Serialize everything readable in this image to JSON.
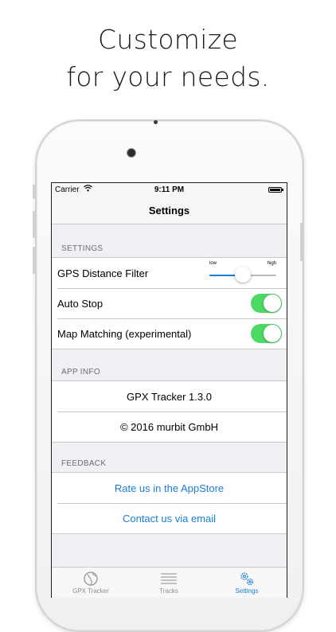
{
  "headline": {
    "line1": "Customize",
    "line2": "for your needs."
  },
  "status_bar": {
    "carrier": "Carrier",
    "time": "9:11 PM"
  },
  "navbar": {
    "title": "Settings"
  },
  "sections": {
    "settings": {
      "header": "SETTINGS",
      "gps_filter": {
        "label": "GPS Distance Filter",
        "low": "low",
        "high": "high",
        "value": 0.5
      },
      "auto_stop": {
        "label": "Auto Stop",
        "on": true
      },
      "map_matching": {
        "label": "Map Matching (experimental)",
        "on": true
      }
    },
    "app_info": {
      "header": "APP INFO",
      "version": "GPX Tracker 1.3.0",
      "copyright": "© 2016 murbit GmbH"
    },
    "feedback": {
      "header": "FEEDBACK",
      "rate": "Rate us in the AppStore",
      "contact": "Contact us via email"
    }
  },
  "tabbar": {
    "tabs": [
      {
        "label": "GPX Tracker",
        "icon": "globe-icon"
      },
      {
        "label": "Tracks",
        "icon": "list-icon"
      },
      {
        "label": "Settings",
        "icon": "gears-icon"
      }
    ],
    "active": "Settings"
  },
  "colors": {
    "accent": "#1a7dd7",
    "toggle_on": "#4cd964",
    "background": "#efeff4"
  }
}
